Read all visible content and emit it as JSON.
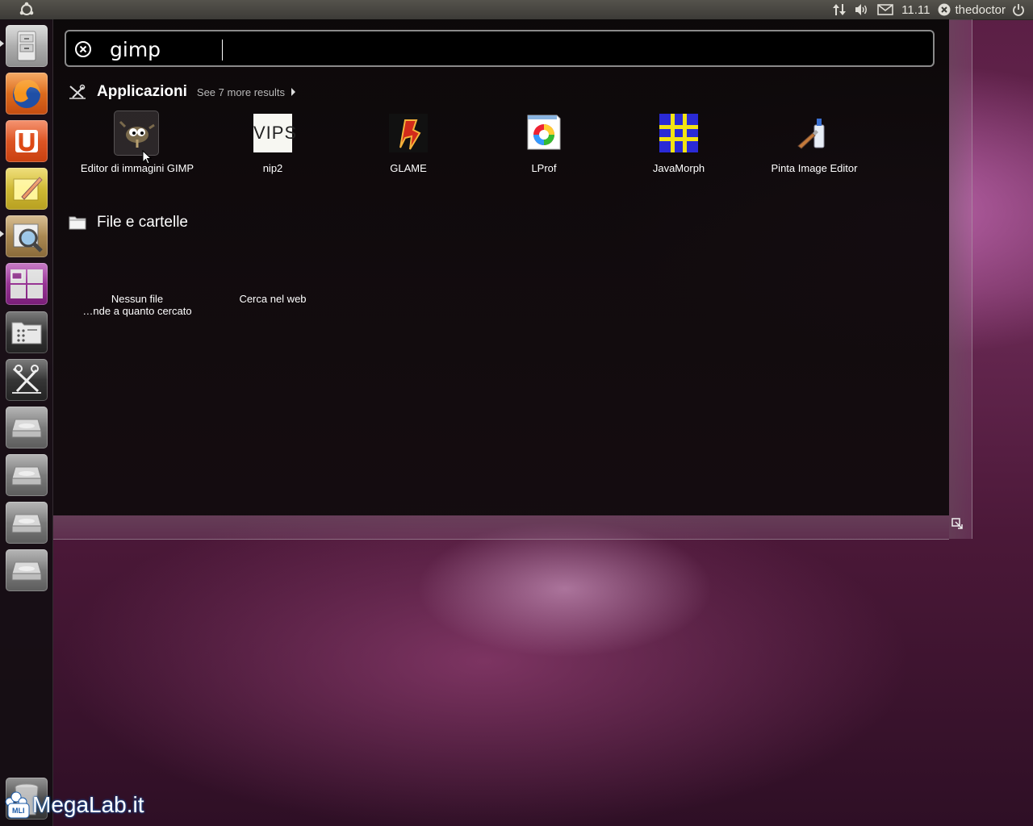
{
  "panel": {
    "clock": "11.11",
    "username": "thedoctor"
  },
  "search": {
    "query": "gimp"
  },
  "categories": {
    "applications": {
      "title": "Applicazioni",
      "more": "See 7 more results"
    },
    "files": {
      "title": "File e cartelle"
    }
  },
  "apps": [
    {
      "label": "Editor di immagini GIMP",
      "icon": "gimp-icon"
    },
    {
      "label": "nip2",
      "icon": "vips-icon"
    },
    {
      "label": "GLAME",
      "icon": "glame-icon"
    },
    {
      "label": "LProf",
      "icon": "lprof-icon"
    },
    {
      "label": "JavaMorph",
      "icon": "javamorph-icon"
    },
    {
      "label": "Pinta Image Editor",
      "icon": "pinta-icon"
    }
  ],
  "vips_text": "VIPS",
  "file_results": {
    "no_files_line1": "Nessun file",
    "no_files_line2": "…nde a quanto cercato",
    "web_search": "Cerca nel web"
  },
  "watermark": {
    "text": "MegaLab.it",
    "badge": "MLI"
  },
  "colors": {
    "panel": "#3c3b37",
    "launcher_bg": "#140e12",
    "wallpaper": "#5a1e44",
    "ubuntu_orange": "#dd4814"
  }
}
